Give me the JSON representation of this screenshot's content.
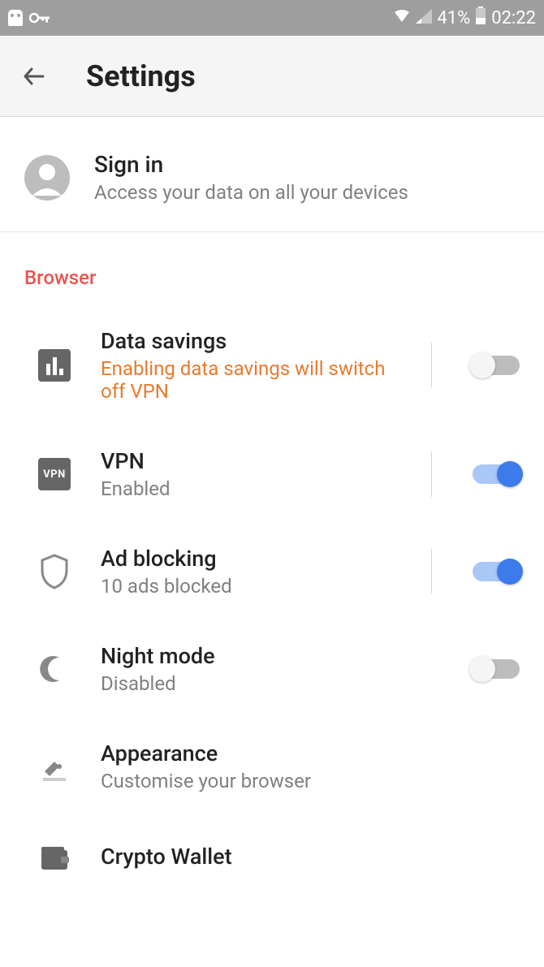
{
  "statusbar": {
    "battery_percent": "41%",
    "time": "02:22"
  },
  "header": {
    "title": "Settings"
  },
  "signin": {
    "title": "Sign in",
    "subtitle": "Access your data on all your devices"
  },
  "section": {
    "browser_label": "Browser"
  },
  "settings": {
    "data_savings": {
      "title": "Data savings",
      "subtitle": "Enabling data savings will switch off VPN",
      "enabled": false
    },
    "vpn": {
      "title": "VPN",
      "subtitle": "Enabled",
      "icon_text": "VPN",
      "enabled": true
    },
    "ad_blocking": {
      "title": "Ad blocking",
      "subtitle": "10 ads blocked",
      "enabled": true
    },
    "night_mode": {
      "title": "Night mode",
      "subtitle": "Disabled",
      "enabled": false
    },
    "appearance": {
      "title": "Appearance",
      "subtitle": "Customise your browser"
    },
    "crypto_wallet": {
      "title": "Crypto Wallet"
    }
  }
}
